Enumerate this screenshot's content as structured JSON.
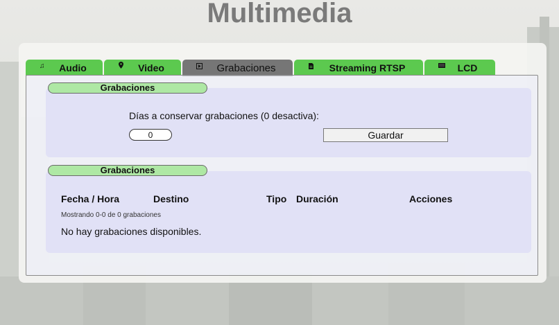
{
  "page": {
    "title": "Multimedia"
  },
  "tabs": [
    {
      "label": "Audio",
      "icon": "music-note-icon",
      "active": false
    },
    {
      "label": "Video",
      "icon": "map-pin-icon",
      "active": false
    },
    {
      "label": "Grabaciones",
      "icon": "play-square-icon",
      "active": true
    },
    {
      "label": "Streaming RTSP",
      "icon": "document-icon",
      "active": false
    },
    {
      "label": "LCD",
      "icon": "monitor-icon",
      "active": false
    }
  ],
  "settings": {
    "section_title": "Grabaciones",
    "days_label": "Días a conservar grabaciones (0 desactiva):",
    "days_value": "0",
    "save_label": "Guardar"
  },
  "recordings": {
    "section_title": "Grabaciones",
    "columns": [
      "Fecha / Hora",
      "Destino",
      "Tipo",
      "Duración",
      "Acciones"
    ],
    "showing_text": "Mostrando 0-0 de 0 grabaciones",
    "empty_text": "No hay grabaciones disponibles."
  },
  "colors": {
    "tab_green": "#5cc94f",
    "tab_active": "#767676",
    "pill_green": "#aee8a4",
    "section_bg": "#dedef6"
  }
}
